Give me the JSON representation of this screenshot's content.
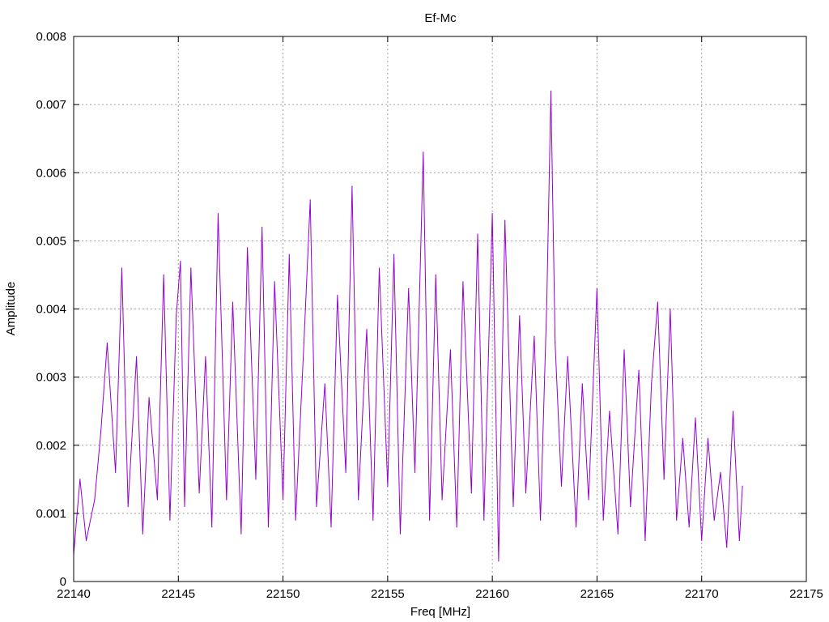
{
  "chart_data": {
    "type": "line",
    "title": "Ef-Mc",
    "xlabel": "Freq [MHz]",
    "ylabel": "Amplitude",
    "xlim": [
      22140,
      22175
    ],
    "ylim": [
      0,
      0.008
    ],
    "x_ticks": [
      "22140",
      "22145",
      "22150",
      "22155",
      "22160",
      "22165",
      "22170",
      "22175"
    ],
    "y_ticks": [
      "0",
      "0.001",
      "0.002",
      "0.003",
      "0.004",
      "0.005",
      "0.006",
      "0.007",
      "0.008"
    ],
    "grid": true,
    "series_color": "#9400d3",
    "series": [
      {
        "x": [
          22140.0,
          22140.3,
          22140.6,
          22141.0,
          22141.3,
          22141.6,
          22142.0,
          22142.3,
          22142.6,
          22143.0,
          22143.3,
          22143.6,
          22144.0,
          22144.3,
          22144.6,
          22144.9,
          22145.1,
          22145.3,
          22145.6,
          22146.0,
          22146.3,
          22146.6,
          22146.9,
          22147.3,
          22147.6,
          22148.0,
          22148.3,
          22148.7,
          22149.0,
          22149.3,
          22149.6,
          22150.0,
          22150.3,
          22150.6,
          22151.0,
          22151.3,
          22151.6,
          22152.0,
          22152.3,
          22152.6,
          22153.0,
          22153.3,
          22153.6,
          22154.0,
          22154.3,
          22154.6,
          22155.0,
          22155.3,
          22155.6,
          22156.0,
          22156.3,
          22156.7,
          22157.0,
          22157.3,
          22157.6,
          22158.0,
          22158.3,
          22158.6,
          22159.0,
          22159.3,
          22159.6,
          22160.0,
          22160.3,
          22160.6,
          22161.0,
          22161.3,
          22161.6,
          22162.0,
          22162.3,
          22162.6,
          22162.8,
          22163.0,
          22163.3,
          22163.6,
          22164.0,
          22164.3,
          22164.6,
          22165.0,
          22165.3,
          22165.6,
          22166.0,
          22166.3,
          22166.6,
          22167.0,
          22167.3,
          22167.6,
          22167.9,
          22168.2,
          22168.5,
          22168.8,
          22169.1,
          22169.4,
          22169.7,
          22170.0,
          22170.3,
          22170.6,
          22170.9,
          22171.2,
          22171.5,
          22171.8,
          22171.95
        ],
        "y": [
          0.0004,
          0.0015,
          0.0006,
          0.0012,
          0.0022,
          0.0035,
          0.0016,
          0.0046,
          0.0011,
          0.0033,
          0.0007,
          0.0027,
          0.0012,
          0.0045,
          0.0009,
          0.0039,
          0.0047,
          0.0011,
          0.0046,
          0.0013,
          0.0033,
          0.0008,
          0.0054,
          0.0012,
          0.0041,
          0.0007,
          0.0049,
          0.0015,
          0.0052,
          0.0008,
          0.0044,
          0.0012,
          0.0048,
          0.0009,
          0.0035,
          0.0056,
          0.0011,
          0.0029,
          0.0008,
          0.0042,
          0.0016,
          0.0058,
          0.0012,
          0.0037,
          0.0009,
          0.0046,
          0.0014,
          0.0048,
          0.0007,
          0.0043,
          0.0016,
          0.0063,
          0.0009,
          0.0045,
          0.0012,
          0.0034,
          0.0008,
          0.0044,
          0.0013,
          0.0051,
          0.0009,
          0.0054,
          0.0003,
          0.0053,
          0.0011,
          0.0039,
          0.0013,
          0.0036,
          0.0009,
          0.0041,
          0.0072,
          0.0035,
          0.0014,
          0.0033,
          0.0008,
          0.0029,
          0.0012,
          0.0043,
          0.0009,
          0.0025,
          0.0007,
          0.0034,
          0.0011,
          0.0031,
          0.0006,
          0.0029,
          0.0041,
          0.0015,
          0.004,
          0.0009,
          0.0021,
          0.0008,
          0.0024,
          0.0006,
          0.0021,
          0.0009,
          0.0016,
          0.0005,
          0.0025,
          0.0006,
          0.0014
        ]
      }
    ]
  }
}
